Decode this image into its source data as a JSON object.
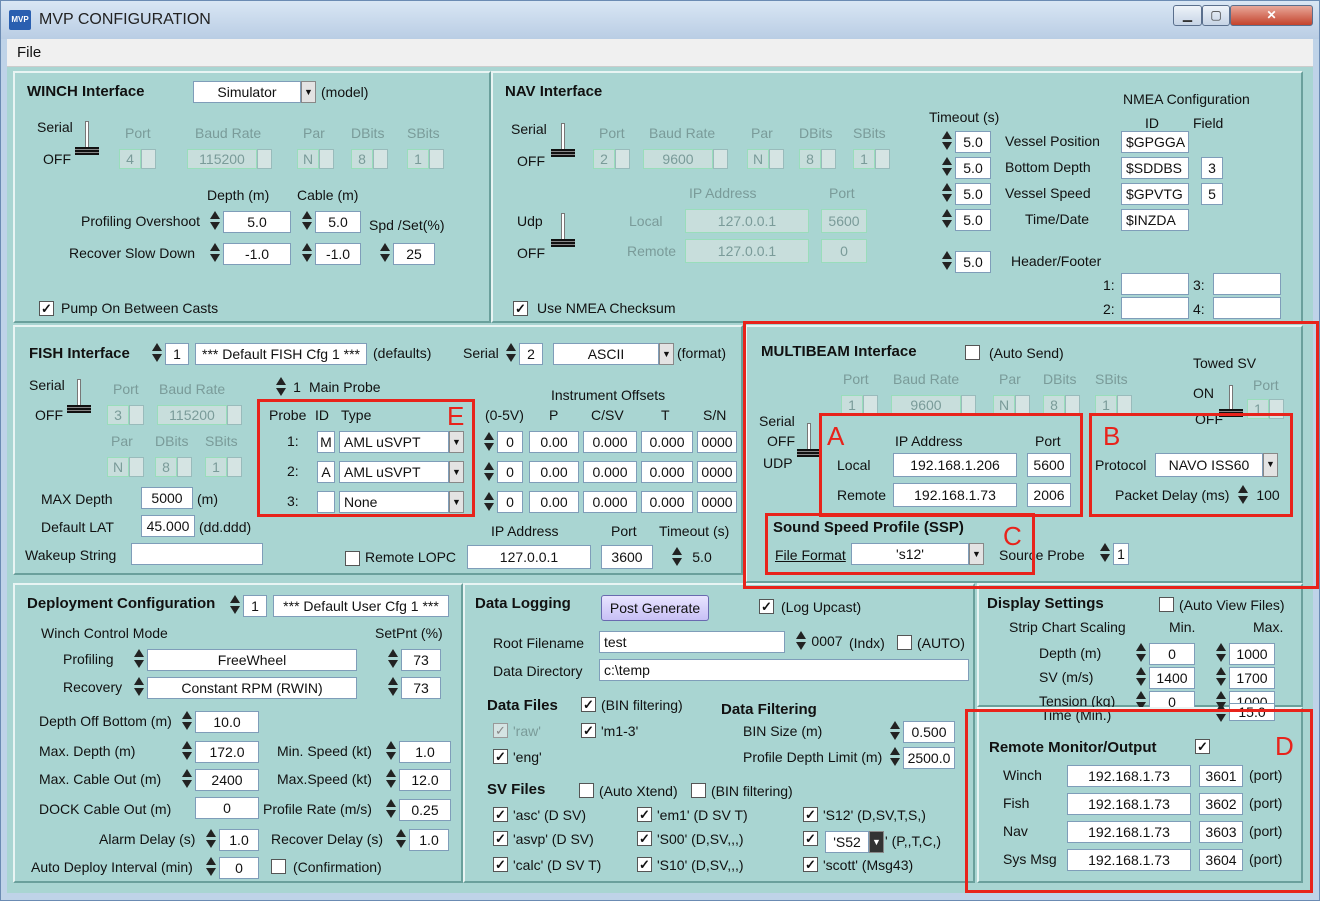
{
  "window": {
    "title": "MVP CONFIGURATION",
    "icon": "MVP",
    "min_icon": "minimize-icon",
    "max_icon": "maximize-icon",
    "close_icon": "close-icon"
  },
  "menu": {
    "file": "File"
  },
  "winch": {
    "title": "WINCH Interface",
    "mode": "Simulator",
    "model": "(model)",
    "serial": "Serial",
    "off": "OFF",
    "port_lbl": "Port",
    "baud_lbl": "Baud Rate",
    "par_lbl": "Par",
    "dbits_lbl": "DBits",
    "sbits_lbl": "SBits",
    "port": "4",
    "baud": "115200",
    "par": "N",
    "dbits": "8",
    "sbits": "1",
    "depth_lbl": "Depth (m)",
    "cable_lbl": "Cable (m)",
    "spd_lbl": "Spd /Set(%)",
    "overshoot_lbl": "Profiling Overshoot",
    "overshoot_depth": "5.0",
    "overshoot_cable": "5.0",
    "slow_lbl": "Recover Slow Down",
    "slow_depth": "-1.0",
    "slow_cable": "-1.0",
    "spd": "25",
    "pump_lbl": "Pump On Between Casts"
  },
  "nav": {
    "title": "NAV Interface",
    "serial": "Serial",
    "off": "OFF",
    "port_lbl": "Port",
    "baud_lbl": "Baud Rate",
    "par_lbl": "Par",
    "dbits_lbl": "DBits",
    "sbits_lbl": "SBits",
    "port": "2",
    "baud": "9600",
    "par": "N",
    "dbits": "8",
    "sbits": "1",
    "ip_lbl": "IP Address",
    "port2_lbl": "Port",
    "udp": "Udp",
    "off2": "OFF",
    "local_lbl": "Local",
    "remote_lbl": "Remote",
    "local_ip": "127.0.0.1",
    "local_port": "5600",
    "remote_ip": "127.0.0.1",
    "remote_port": "0",
    "checksum_lbl": "Use NMEA Checksum",
    "timeout_lbl": "Timeout (s)",
    "nmea_lbl": "NMEA Configuration",
    "id_lbl": "ID",
    "field_lbl": "Field",
    "rows": [
      {
        "t": "5.0",
        "name": "Vessel Position",
        "id": "$GPGGA",
        "field": ""
      },
      {
        "t": "5.0",
        "name": "Bottom Depth",
        "id": "$SDDBS",
        "field": "3"
      },
      {
        "t": "5.0",
        "name": "Vessel Speed",
        "id": "$GPVTG",
        "field": "5"
      },
      {
        "t": "5.0",
        "name": "Time/Date",
        "id": "$INZDA",
        "field": ""
      }
    ],
    "hf_t": "5.0",
    "hf_lbl": "Header/Footer",
    "hf1": "1:",
    "hf2": "2:",
    "hf3": "3:",
    "hf4": "4:"
  },
  "fish": {
    "title": "FISH Interface",
    "num": "1",
    "cfg": "*** Default FISH Cfg 1 ***",
    "defaults": "(defaults)",
    "serial_lbl": "Serial",
    "serial_num": "2",
    "format": "ASCII",
    "format_lbl": "(format)",
    "serial": "Serial",
    "off": "OFF",
    "port_lbl": "Port",
    "baud_lbl": "Baud Rate",
    "port": "3",
    "baud": "115200",
    "par_lbl": "Par",
    "dbits_lbl": "DBits",
    "sbits_lbl": "SBits",
    "par": "N",
    "dbits": "8",
    "sbits": "1",
    "main_num": "1",
    "main_lbl": "Main Probe",
    "probe_lbl": "Probe",
    "id_lbl": "ID",
    "type_lbl": "Type",
    "inst_lbl": "Instrument Offsets",
    "v_lbl": "(0-5V)",
    "p_lbl": "P",
    "csv_lbl": "C/SV",
    "t_lbl": "T",
    "sn_lbl": "S/N",
    "probes": [
      {
        "n": "1:",
        "id": "M",
        "type": "AML uSVPT",
        "v": "0",
        "p": "0.00",
        "c": "0.000",
        "t": "0.000",
        "sn": "0000"
      },
      {
        "n": "2:",
        "id": "A",
        "type": "AML uSVPT",
        "v": "0",
        "p": "0.00",
        "c": "0.000",
        "t": "0.000",
        "sn": "0000"
      },
      {
        "n": "3:",
        "id": "",
        "type": "None",
        "v": "0",
        "p": "0.00",
        "c": "0.000",
        "t": "0.000",
        "sn": "0000"
      }
    ],
    "maxd_lbl": "MAX Depth",
    "maxd": "5000",
    "m": "(m)",
    "lat_lbl": "Default LAT",
    "lat": "45.000",
    "ddd": "(dd.ddd)",
    "wake_lbl": "Wakeup String",
    "wake": "",
    "lopc_lbl": "Remote LOPC",
    "ip_lbl": "IP Address",
    "port2_lbl": "Port",
    "to_lbl": "Timeout (s)",
    "ip": "127.0.0.1",
    "port2": "3600",
    "to": "5.0"
  },
  "mb": {
    "title": "MULTIBEAM Interface",
    "auto": "(Auto Send)",
    "towed": "Towed SV",
    "on": "ON",
    "off": "OFF",
    "port_lbl": "Port",
    "baud_lbl": "Baud Rate",
    "par_lbl": "Par",
    "dbits_lbl": "DBits",
    "sbits_lbl": "SBits",
    "port": "1",
    "baud": "9600",
    "par": "N",
    "dbits": "8",
    "sbits": "1",
    "tport_lbl": "Port",
    "tport": "1",
    "serial": "Serial",
    "off2": "OFF",
    "udp": "UDP",
    "ip_lbl": "IP Address",
    "port2_lbl": "Port",
    "local_lbl": "Local",
    "remote_lbl": "Remote",
    "local_ip": "192.168.1.206",
    "local_port": "5600",
    "remote_ip": "192.168.1.73",
    "remote_port": "2006",
    "proto_lbl": "Protocol",
    "proto": "NAVO ISS60",
    "delay_lbl": "Packet Delay (ms)",
    "delay": "100",
    "ssp": "Sound Speed Profile (SSP)",
    "ff_lbl": "File Format",
    "ff": "'s12'",
    "src_lbl": "Source Probe",
    "src": "1"
  },
  "deploy": {
    "title": "Deployment Configuration",
    "num": "1",
    "cfg": "*** Default User Cfg 1 ***",
    "mode_lbl": "Winch Control Mode",
    "setpnt": "SetPnt (%)",
    "prof_lbl": "Profiling",
    "prof": "FreeWheel",
    "prof_set": "73",
    "rec_lbl": "Recovery",
    "rec": "Constant RPM (RWIN)",
    "rec_set": "73",
    "dob_lbl": "Depth Off Bottom (m)",
    "dob": "10.0",
    "maxd_lbl": "Max. Depth (m)",
    "maxd": "172.0",
    "minspd_lbl": "Min. Speed (kt)",
    "minspd": "1.0",
    "maxc_lbl": "Max. Cable Out (m)",
    "maxc": "2400",
    "maxspd_lbl": "Max.Speed (kt)",
    "maxspd": "12.0",
    "dock_lbl": "DOCK Cable Out (m)",
    "dock": "0",
    "rate_lbl": "Profile Rate (m/s)",
    "rate": "0.25",
    "alarm_lbl": "Alarm Delay (s)",
    "alarm": "1.0",
    "recd_lbl": "Recover Delay (s)",
    "recd": "1.0",
    "auto_lbl": "Auto Deploy Interval (min)",
    "auto": "0",
    "conf_lbl": "(Confirmation)"
  },
  "log": {
    "title": "Data Logging",
    "post": "Post Generate",
    "upcast": "(Log Upcast)",
    "root_lbl": "Root Filename",
    "root": "test",
    "indx": "0007",
    "indx_lbl": "(Indx)",
    "auto_lbl": "(AUTO)",
    "dir_lbl": "Data Directory",
    "dir": "c:\\temp",
    "df_lbl": "Data Files",
    "bin_lbl": "(BIN filtering)",
    "raw": "'raw'",
    "m13": "'m1-3'",
    "eng": "'eng'",
    "filt_lbl": "Data Filtering",
    "binsize_lbl": "BIN Size (m)",
    "binsize": "0.500",
    "pdl_lbl": "Profile Depth Limit (m)",
    "pdl": "2500.0",
    "sv_lbl": "SV Files",
    "xtend": "(Auto Xtend)",
    "bin2": "(BIN filtering)",
    "sv": [
      "'asc' (D SV)",
      "'em1' (D SV T)",
      "'S12'  (D,SV,T,S,)",
      "'asvp' (D SV)",
      "'S00' (D,SV,,,)",
      "'calc' (D SV T)",
      "'S10' (D,SV,,,)",
      "'scott'  (Msg43)"
    ],
    "s52": "'S52",
    "s52b": "' (P,,T,C,)"
  },
  "disp": {
    "title": "Display Settings",
    "autoview": "(Auto View Files)",
    "strip": "Strip Chart Scaling",
    "min": "Min.",
    "max": "Max.",
    "rows": [
      {
        "l": "Depth (m)",
        "mn": "0",
        "mx": "1000"
      },
      {
        "l": "SV (m/s)",
        "mn": "1400",
        "mx": "1700"
      },
      {
        "l": "Tension (kg)",
        "mn": "0",
        "mx": "1000"
      }
    ],
    "time_lbl": "Time (Min.)",
    "time_mx": "15.0"
  },
  "remote": {
    "title": "Remote Monitor/Output",
    "rows": [
      {
        "l": "Winch",
        "ip": "192.168.1.73",
        "p": "3601"
      },
      {
        "l": "Fish",
        "ip": "192.168.1.73",
        "p": "3602"
      },
      {
        "l": "Nav",
        "ip": "192.168.1.73",
        "p": "3603"
      },
      {
        "l": "Sys Msg",
        "ip": "192.168.1.73",
        "p": "3604"
      }
    ],
    "port": "(port)"
  },
  "annotations": {
    "A": "A",
    "B": "B",
    "C": "C",
    "D": "D",
    "E": "E",
    "color": "#e8231b"
  }
}
